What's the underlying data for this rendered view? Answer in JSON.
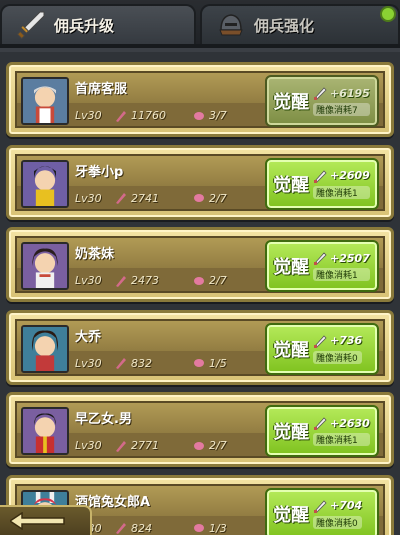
{
  "tabs": [
    {
      "label": "佣兵升级",
      "icon": "sword-icon",
      "active": true
    },
    {
      "label": "佣兵强化",
      "icon": "helmet-icon",
      "active": false
    }
  ],
  "colors": {
    "awaken_green": "#8fd12a",
    "card_gold": "#e5d08a",
    "notify_green": "#8ad133"
  },
  "mercenaries": [
    {
      "name": "首席客服",
      "level": "Lv30",
      "power": "11760",
      "fragments": "3/7",
      "awaken_label": "觉醒",
      "awaken_cost": "+6195",
      "awaken_sub": "雕像消耗7",
      "avatar": "maid-avatar"
    },
    {
      "name": "牙拳小p",
      "level": "Lv30",
      "power": "2741",
      "fragments": "2/7",
      "awaken_label": "觉醒",
      "awaken_cost": "+2609",
      "awaken_sub": "雕像消耗1",
      "avatar": "fighter-avatar"
    },
    {
      "name": "奶茶妹",
      "level": "Lv30",
      "power": "2473",
      "fragments": "2/7",
      "awaken_label": "觉醒",
      "awaken_cost": "+2507",
      "awaken_sub": "雕像消耗1",
      "avatar": "girl-avatar"
    },
    {
      "name": "大乔",
      "level": "Lv30",
      "power": "832",
      "fragments": "1/5",
      "awaken_label": "觉醒",
      "awaken_cost": "+736",
      "awaken_sub": "雕像消耗0",
      "avatar": "daqiao-avatar"
    },
    {
      "name": "早乙女.男",
      "level": "Lv30",
      "power": "2771",
      "fragments": "2/7",
      "awaken_label": "觉醒",
      "awaken_cost": "+2630",
      "awaken_sub": "雕像消耗1",
      "avatar": "ranma-avatar"
    },
    {
      "name": "酒馆兔女郎A",
      "level": "Lv30",
      "power": "824",
      "fragments": "1/3",
      "awaken_label": "觉醒",
      "awaken_cost": "+704",
      "awaken_sub": "雕像消耗0",
      "avatar": "bunny-avatar"
    }
  ]
}
